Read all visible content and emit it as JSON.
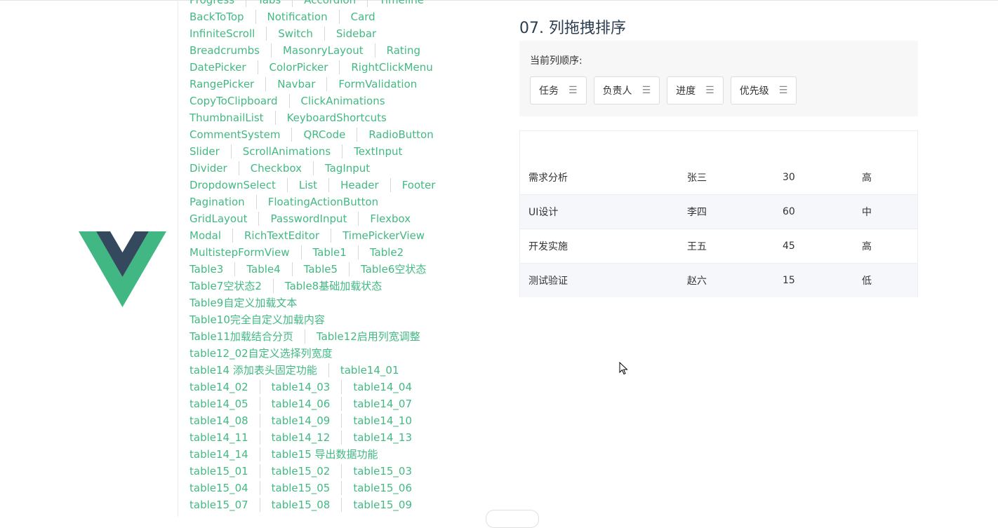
{
  "nav_rows": [
    [
      "Progress",
      "Tabs",
      "Accordion",
      "Timeline"
    ],
    [
      "BackToTop",
      "Notification",
      "Card"
    ],
    [
      "InfiniteScroll",
      "Switch",
      "Sidebar"
    ],
    [
      "Breadcrumbs",
      "MasonryLayout",
      "Rating"
    ],
    [
      "DatePicker",
      "ColorPicker",
      "RightClickMenu"
    ],
    [
      "RangePicker",
      "Navbar",
      "FormValidation"
    ],
    [
      "CopyToClipboard",
      "ClickAnimations"
    ],
    [
      "ThumbnailList",
      "KeyboardShortcuts"
    ],
    [
      "CommentSystem",
      "QRCode",
      "RadioButton"
    ],
    [
      "Slider",
      "ScrollAnimations",
      "TextInput"
    ],
    [
      "Divider",
      "Checkbox",
      "TagInput"
    ],
    [
      "DropdownSelect",
      "List",
      "Header",
      "Footer"
    ],
    [
      "Pagination",
      "FloatingActionButton"
    ],
    [
      "GridLayout",
      "PasswordInput",
      "Flexbox"
    ],
    [
      "Modal",
      "RichTextEditor",
      "TimePickerView"
    ],
    [
      "MultistepFormView",
      "Table1",
      "Table2"
    ],
    [
      "Table3",
      "Table4",
      "Table5",
      "Table6空状态"
    ],
    [
      "Table7空状态2",
      "Table8基础加载状态"
    ],
    [
      "Table9自定义加载文本"
    ],
    [
      "Table10完全自定义加载内容"
    ],
    [
      "Table11加载结合分页",
      "Table12启用列宽调整"
    ],
    [
      "table12_02自定义选择列宽度"
    ],
    [
      "table14 添加表头固定功能",
      "table14_01"
    ],
    [
      "table14_02",
      "table14_03",
      "table14_04"
    ],
    [
      "table14_05",
      "table14_06",
      "table14_07"
    ],
    [
      "table14_08",
      "table14_09",
      "table14_10"
    ],
    [
      "table14_11",
      "table14_12",
      "table14_13"
    ],
    [
      "table14_14",
      "table15 导出数据功能"
    ],
    [
      "table15_01",
      "table15_02",
      "table15_03"
    ],
    [
      "table15_04",
      "table15_05",
      "table15_06"
    ],
    [
      "table15_07",
      "table15_08",
      "table15_09"
    ]
  ],
  "section": {
    "title": "07. 列拖拽排序",
    "order_label": "当前列顺序:",
    "columns": [
      "任务",
      "负责人",
      "进度",
      "优先级"
    ],
    "grip_icon": "☰"
  },
  "table": {
    "rows": [
      [
        "需求分析",
        "张三",
        "30",
        "高"
      ],
      [
        "UI设计",
        "李四",
        "60",
        "中"
      ],
      [
        "开发实施",
        "王五",
        "45",
        "高"
      ],
      [
        "测试验证",
        "赵六",
        "15",
        "低"
      ]
    ]
  },
  "colors": {
    "link": "#42b983",
    "logo_green": "#41b883",
    "logo_dark": "#35495e"
  }
}
